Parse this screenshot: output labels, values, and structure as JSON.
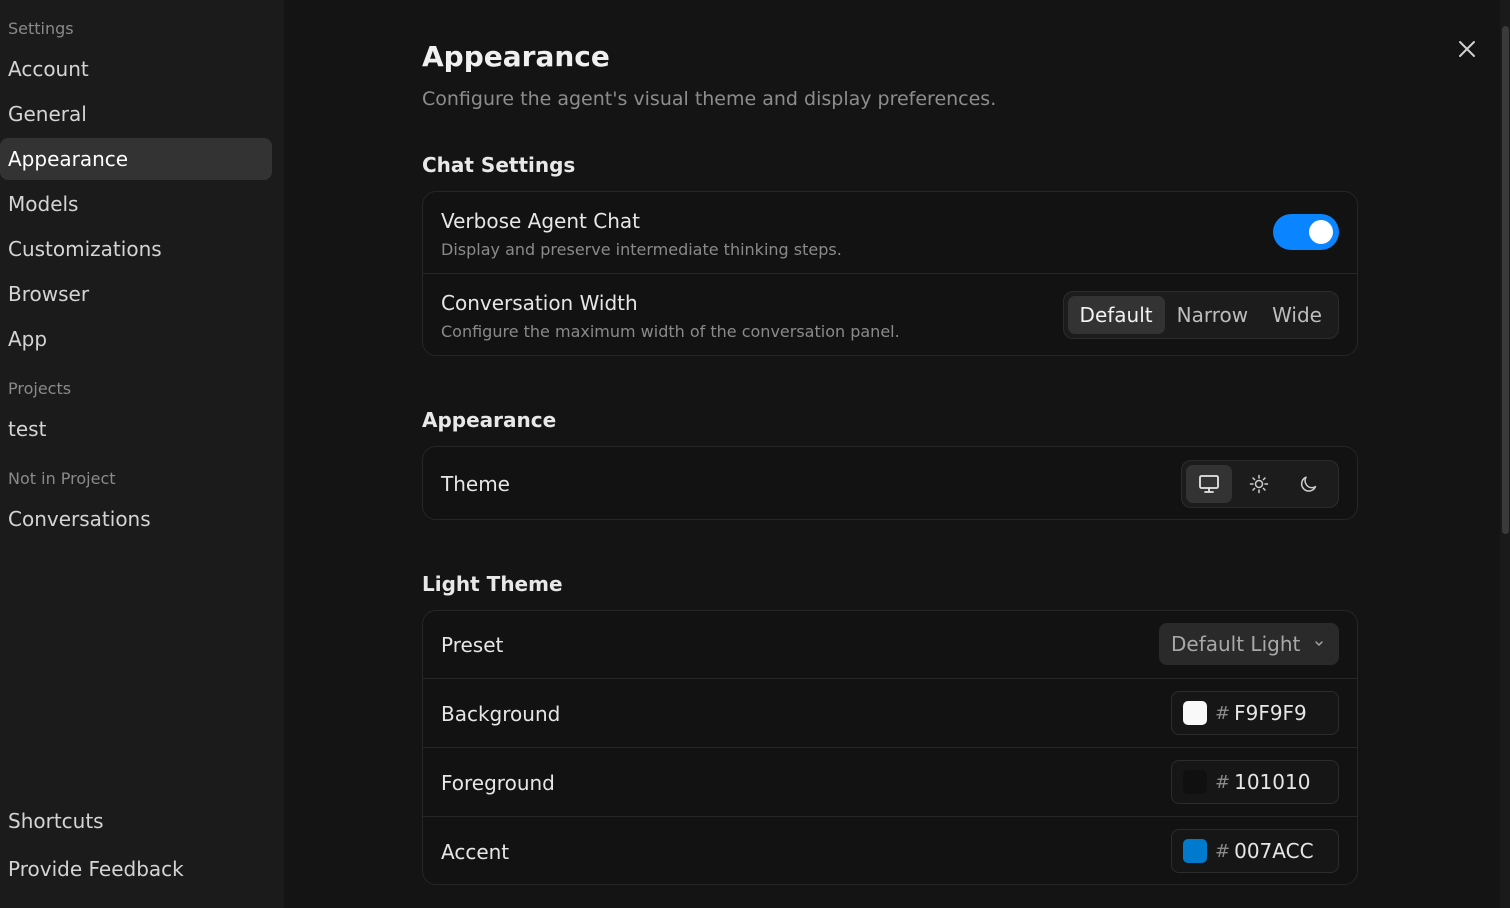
{
  "sidebar": {
    "section_settings": "Settings",
    "settings_items": [
      {
        "label": "Account"
      },
      {
        "label": "General"
      },
      {
        "label": "Appearance",
        "active": true
      },
      {
        "label": "Models"
      },
      {
        "label": "Customizations"
      },
      {
        "label": "Browser"
      },
      {
        "label": "App"
      }
    ],
    "section_projects": "Projects",
    "project_items": [
      {
        "label": "test"
      }
    ],
    "section_not_in_project": "Not in Project",
    "not_in_project_items": [
      {
        "label": "Conversations"
      }
    ],
    "footer_items": [
      {
        "label": "Shortcuts"
      },
      {
        "label": "Provide Feedback"
      }
    ]
  },
  "header": {
    "title": "Appearance",
    "subtitle": "Configure the agent's visual theme and display preferences.",
    "close_icon": "close-icon"
  },
  "chat_settings": {
    "title": "Chat Settings",
    "verbose": {
      "label": "Verbose Agent Chat",
      "description": "Display and preserve intermediate thinking steps.",
      "enabled": true
    },
    "width": {
      "label": "Conversation Width",
      "description": "Configure the maximum width of the conversation panel.",
      "options": [
        "Default",
        "Narrow",
        "Wide"
      ],
      "selected": "Default"
    }
  },
  "appearance": {
    "title": "Appearance",
    "theme": {
      "label": "Theme",
      "options": [
        "monitor-icon",
        "sun-icon",
        "moon-icon"
      ],
      "selected": "monitor-icon"
    }
  },
  "light_theme": {
    "title": "Light Theme",
    "preset": {
      "label": "Preset",
      "value": "Default Light"
    },
    "background": {
      "label": "Background",
      "hash": "#",
      "value": "F9F9F9",
      "color": "#F9F9F9"
    },
    "foreground": {
      "label": "Foreground",
      "hash": "#",
      "value": "101010",
      "color": "#101010"
    },
    "accent": {
      "label": "Accent",
      "hash": "#",
      "value": "007ACC",
      "color": "#007ACC"
    }
  },
  "colors": {
    "toggle_on": "#0A84FF",
    "sidebar_bg": "#1B1B1B",
    "main_bg": "#141414"
  }
}
